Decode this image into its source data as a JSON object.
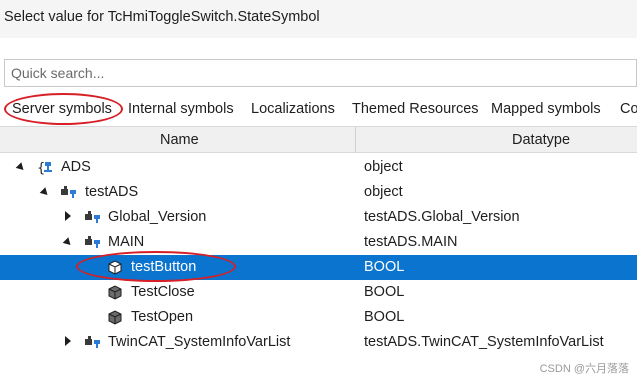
{
  "window": {
    "title": "Select value for TcHmiToggleSwitch.StateSymbol"
  },
  "search": {
    "placeholder": "Quick search..."
  },
  "tabs": [
    {
      "label": "Server symbols",
      "selected": true
    },
    {
      "label": "Internal symbols"
    },
    {
      "label": "Localizations"
    },
    {
      "label": "Themed Resources"
    },
    {
      "label": "Mapped symbols"
    },
    {
      "label": "Co"
    }
  ],
  "table": {
    "columns": {
      "name": "Name",
      "type": "Datatype"
    },
    "rows": [
      {
        "name": "ADS",
        "type": "object",
        "icon": "braces-symbol-icon",
        "expanded": true
      },
      {
        "name": "testADS",
        "type": "object",
        "icon": "network-symbol-icon",
        "expanded": true
      },
      {
        "name": "Global_Version",
        "type": "testADS.Global_Version",
        "icon": "network-symbol-icon",
        "expanded": false
      },
      {
        "name": "MAIN",
        "type": "testADS.MAIN",
        "icon": "network-symbol-icon",
        "expanded": true
      },
      {
        "name": "testButton",
        "type": "BOOL",
        "icon": "variable-icon",
        "selected": true
      },
      {
        "name": "TestClose",
        "type": "BOOL",
        "icon": "variable-icon"
      },
      {
        "name": "TestOpen",
        "type": "BOOL",
        "icon": "variable-icon"
      },
      {
        "name": "TwinCAT_SystemInfoVarList",
        "type": "testADS.TwinCAT_SystemInfoVarList",
        "icon": "network-symbol-icon",
        "expanded": false
      }
    ]
  },
  "watermark": "CSDN @六月落落",
  "colors": {
    "selection": "#0a74cf",
    "annotation": "#d71f26"
  }
}
